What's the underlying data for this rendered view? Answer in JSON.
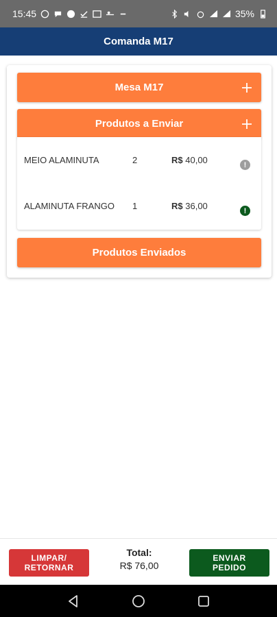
{
  "status_bar": {
    "time": "15:45",
    "battery": "35%"
  },
  "app_bar": {
    "title": "Comanda M17"
  },
  "sections": {
    "mesa": {
      "label": "Mesa M17",
      "icon": "plus-icon"
    },
    "to_send": {
      "label": "Produtos a Enviar",
      "icon": "plus-icon"
    },
    "sent": {
      "label": "Produtos Enviados"
    }
  },
  "products": [
    {
      "name": "MEIO ALAMINUTA",
      "qty": "2",
      "currency": "R$",
      "price": "40,00",
      "status_icon": "info-icon",
      "status_color": "#9e9e9e"
    },
    {
      "name": "ALAMINUTA FRANGO",
      "qty": "1",
      "currency": "R$",
      "price": "36,00",
      "status_icon": "info-icon",
      "status_color": "#0c5a1e"
    }
  ],
  "footer": {
    "clear_label_1": "LIMPAR/",
    "clear_label_2": "RETORNAR",
    "total_label": "Total:",
    "total_value": "R$ 76,00",
    "send_label_1": "ENVIAR",
    "send_label_2": "PEDIDO"
  },
  "colors": {
    "app_bar": "#163e75",
    "accent": "#fe7d3c",
    "clear_button": "#d63738",
    "send_button": "#0c5a1e"
  }
}
